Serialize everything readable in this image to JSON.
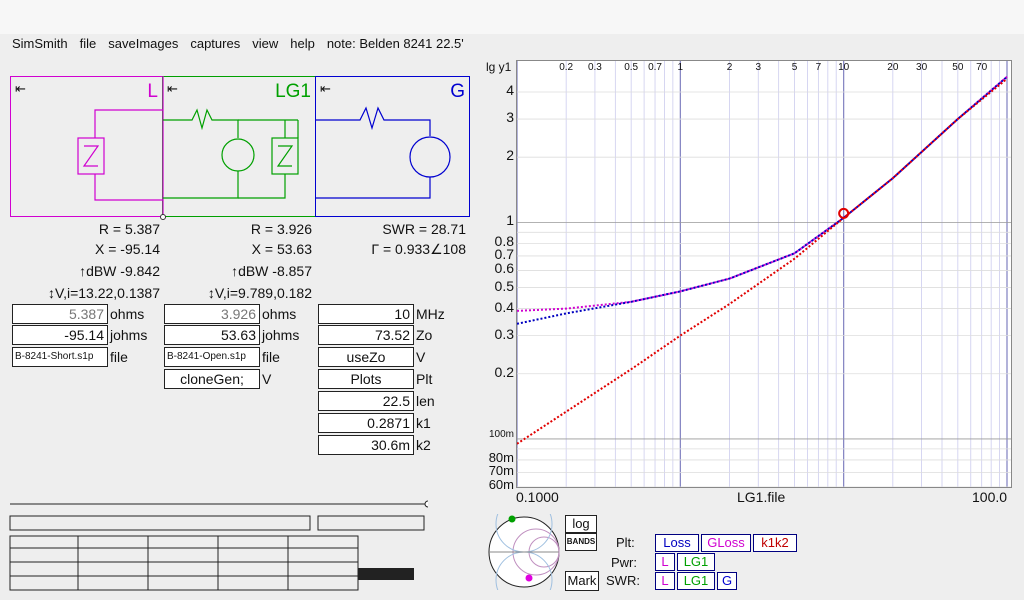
{
  "menu": [
    "SimSmith",
    "file",
    "saveImages",
    "captures",
    "view",
    "help",
    "note: Belden 8241 22.5'"
  ],
  "blocks": {
    "L": {
      "label": "L",
      "color": "#d000d0"
    },
    "LG1": {
      "label": "LG1",
      "color": "#00a000"
    },
    "G": {
      "label": "G",
      "color": "#0000d0"
    }
  },
  "readouts": {
    "L": {
      "r": "R = 5.387",
      "x": "X = -95.14",
      "dbw": "↑dBW -9.842",
      "vi": "↕V,i=13.22,0.1387"
    },
    "LG1": {
      "r": "R = 3.926",
      "x": "X = 53.63",
      "dbw": "↑dBW -8.857",
      "vi": "↕V,i=9.789,0.182"
    },
    "G": {
      "swr": "SWR = 28.71",
      "gamma": "Γ = 0.933∠108"
    }
  },
  "fields": {
    "L": [
      {
        "value": "5.387",
        "unit": "ohms"
      },
      {
        "value": "-95.14",
        "unit": "johms"
      },
      {
        "value": "B-8241-Short.s1p",
        "unit": "file"
      }
    ],
    "LG1": [
      {
        "value": "3.926",
        "unit": "ohms"
      },
      {
        "value": "53.63",
        "unit": "johms"
      },
      {
        "value": "B-8241-Open.s1p",
        "unit": "file"
      },
      {
        "value": "cloneGen;",
        "unit": "V"
      }
    ],
    "G": [
      {
        "value": "10",
        "unit": "MHz"
      },
      {
        "value": "73.52",
        "unit": "Zo"
      },
      {
        "value": "useZo",
        "unit": "V"
      },
      {
        "value": "Plots",
        "unit": "Plt"
      },
      {
        "value": "22.5",
        "unit": "len"
      },
      {
        "value": "0.2871",
        "unit": "k1"
      },
      {
        "value": "30.6m",
        "unit": "k2"
      }
    ]
  },
  "plot": {
    "y_axis_title": "lg y1",
    "x_axis_title": "LG1.file",
    "x_min_label": "0.1000",
    "x_max_label": "100.0",
    "top_ticks": [
      "0.2",
      "0.3",
      "0.5",
      "0.7",
      "1",
      "2",
      "3",
      "5",
      "7",
      "10",
      "20",
      "30",
      "50",
      "70"
    ],
    "y_ticks": [
      "4",
      "3",
      "2",
      "1",
      "0.8",
      "0.7",
      "0.6",
      "0.5",
      "0.4",
      "0.3",
      "0.2",
      "100m",
      "80m",
      "70m",
      "60m"
    ],
    "marker_color": "#e00000"
  },
  "chart_data": {
    "type": "line",
    "title": "",
    "xlabel": "LG1.file",
    "ylabel": "lg y1",
    "x_scale": "log",
    "y_scale": "log",
    "xlim": [
      0.1,
      100
    ],
    "ylim": [
      0.06,
      5
    ],
    "grid": true,
    "series": [
      {
        "color": "#d000d0",
        "style": "dotted",
        "x": [
          0.1,
          0.2,
          0.5,
          1,
          2,
          5,
          10,
          20,
          50,
          100
        ],
        "y": [
          0.39,
          0.4,
          0.43,
          0.48,
          0.55,
          0.72,
          1.05,
          1.6,
          3.0,
          4.7
        ]
      },
      {
        "color": "#0000c0",
        "style": "dotted",
        "x": [
          0.1,
          0.2,
          0.5,
          1,
          2,
          5,
          10,
          20,
          50,
          100
        ],
        "y": [
          0.34,
          0.38,
          0.43,
          0.48,
          0.55,
          0.72,
          1.05,
          1.6,
          3.0,
          4.7
        ]
      },
      {
        "color": "#e00000",
        "style": "dotted",
        "x": [
          0.1,
          0.5,
          1,
          2,
          5,
          10,
          20,
          50,
          100
        ],
        "y": [
          0.095,
          0.21,
          0.3,
          0.42,
          0.68,
          1.05,
          1.6,
          3.0,
          4.6
        ]
      }
    ],
    "marker": {
      "x": 10,
      "y": 1.1
    }
  },
  "controls": {
    "log_label": "log",
    "bands_label": "BANDS",
    "mark_label": "Mark",
    "plt_label": "Plt:",
    "pwr_label": "Pwr:",
    "swr_label": "SWR:",
    "plt_buttons": [
      {
        "label": "Loss",
        "color": "#0000c0"
      },
      {
        "label": "GLoss",
        "color": "#d000d0"
      },
      {
        "label": "k1k2",
        "color": "#c00000"
      }
    ],
    "pwr_buttons": [
      "L",
      "LG1"
    ],
    "swr_buttons": [
      "L",
      "LG1",
      "G"
    ]
  }
}
